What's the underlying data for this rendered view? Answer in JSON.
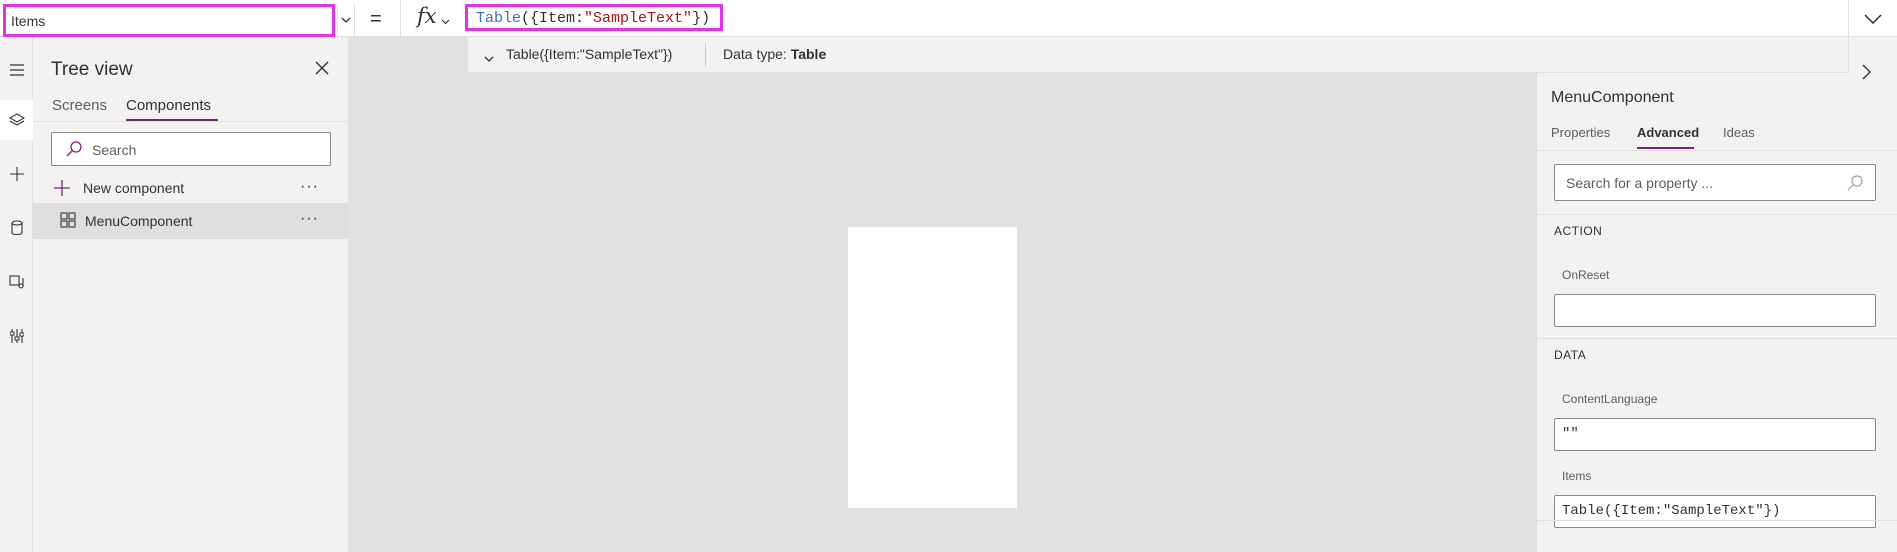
{
  "formula_bar": {
    "property_value": "Items",
    "equals": "=",
    "fx_label": "fx",
    "formula_tokens": {
      "fn": "Table",
      "open": "({Item:",
      "str": "\"SampleText\"",
      "close": "})"
    }
  },
  "result": {
    "expression": "Table({Item:\"SampleText\"})",
    "datatype_label": "Data type: ",
    "datatype_value": "Table"
  },
  "tree_view": {
    "title": "Tree view",
    "tabs": [
      "Screens",
      "Components"
    ],
    "active_tab": "Components",
    "search_placeholder": "Search",
    "new_component_label": "New component",
    "items": [
      {
        "label": "MenuComponent"
      }
    ],
    "more_label": "···"
  },
  "properties_panel": {
    "component_name": "MenuComponent",
    "tabs": [
      "Properties",
      "Advanced",
      "Ideas"
    ],
    "active_tab": "Advanced",
    "search_placeholder": "Search for a property ...",
    "sections": [
      {
        "heading": "ACTION",
        "fields": [
          {
            "label": "OnReset",
            "value": ""
          }
        ]
      },
      {
        "heading": "DATA",
        "fields": [
          {
            "label": "ContentLanguage",
            "value": "\"\""
          },
          {
            "label": "Items",
            "value": "Table({Item:\"SampleText\"})"
          }
        ]
      }
    ]
  },
  "icons": {
    "rail": [
      "hamburger-icon",
      "layers-icon",
      "plus-icon",
      "data-icon",
      "media-icon",
      "tools-icon"
    ]
  },
  "colors": {
    "highlight": "#e233e2",
    "accent": "#742774",
    "canvas": "#e1e1e1",
    "panel": "#f3f2f1"
  }
}
